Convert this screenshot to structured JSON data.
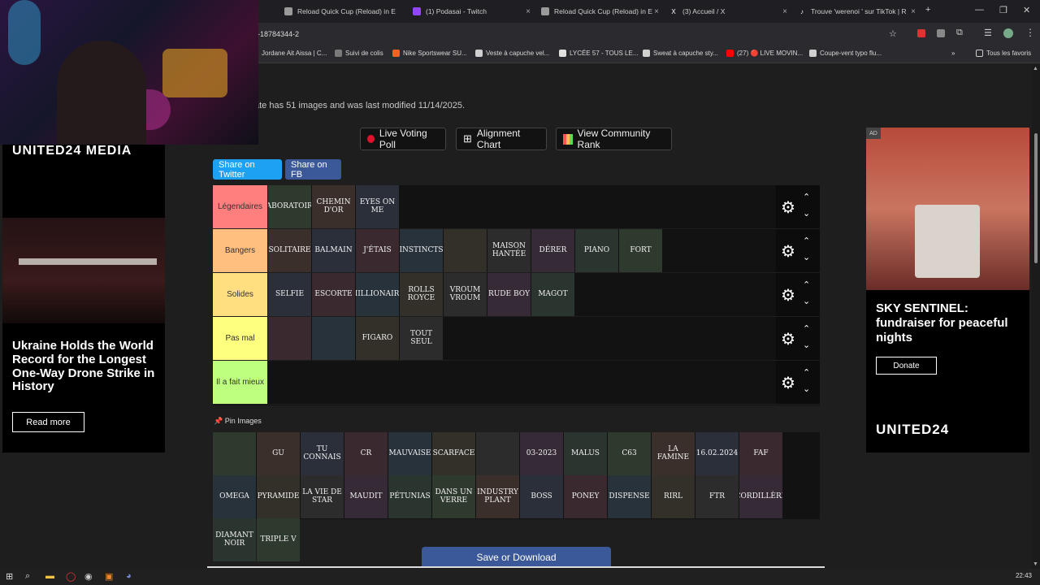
{
  "browser": {
    "tabs": [
      {
        "title": "Reload Quick Cup (Reload) in E",
        "icon_color": "#9a9a9a"
      },
      {
        "title": "(1) Podasai - Twitch",
        "icon_color": "#9146ff"
      },
      {
        "title": "Reload Quick Cup (Reload) in E",
        "icon_color": "#9a9a9a"
      },
      {
        "title": "(3) Accueil / X",
        "icon_color": "#ffffff"
      },
      {
        "title": "Trouve 'werenoi ' sur TikTok | R",
        "icon_color": "#ffffff"
      }
    ],
    "new_tab": "+",
    "url": "i-18784344-2",
    "bookmarks": [
      {
        "label": "Jordane Ait Aissa | C...",
        "color": "#7a7a7a"
      },
      {
        "label": "Suivi de colis",
        "color": "#7a7a7a"
      },
      {
        "label": "Nike Sportswear SU...",
        "color": "#f26322"
      },
      {
        "label": "Veste à capuche vel...",
        "color": "#d0d0d0"
      },
      {
        "label": "LYCÉE 57 - TOUS LE...",
        "color": "#e0e0e0"
      },
      {
        "label": "Sweat à capuche sty...",
        "color": "#d0d0d0"
      },
      {
        "label": "(27) 🔴 LIVE MOVIN...",
        "color": "#ff0000"
      },
      {
        "label": "Coupe-vent typo flu...",
        "color": "#d0d0d0"
      }
    ],
    "all_bookmarks": "Tous les favoris"
  },
  "page": {
    "subline": "ate has 51 images and was last modified 11/14/2025.",
    "buttons": {
      "live_poll": "Live Voting Poll",
      "alignment": "Alignment Chart",
      "community": "View Community Rank"
    },
    "share_twitter": "Share on Twitter",
    "share_fb": "Share on FB",
    "pin_images": "Pin Images",
    "save_download": "Save or Download"
  },
  "tiers": [
    {
      "label": "Légendaires",
      "color": "#ff7f7f",
      "items": [
        "LABORATOIRE",
        "CHEMIN D'OR",
        "EYES ON ME"
      ]
    },
    {
      "label": "Bangers",
      "color": "#ffbf7f",
      "items": [
        "SOLITAIRE",
        "BALMAIN",
        "J'ÉTAIS",
        "INSTINCTS",
        "",
        "MAISON HANTÉE",
        "DÉRER",
        "PIANO",
        "FORT"
      ]
    },
    {
      "label": "Solides",
      "color": "#ffdf7f",
      "items": [
        "SELFIE",
        "ESCORTE",
        "MILLIONAIRE",
        "ROLLS ROYCE",
        "VROUM VROUM",
        "RUDE BOY",
        "MAGOT"
      ]
    },
    {
      "label": "Pas mal",
      "color": "#ffff7f",
      "items": [
        "",
        "",
        "FIGARO",
        "TOUT SEUL"
      ]
    },
    {
      "label": "Il a fait mieux",
      "color": "#bfff7f",
      "items": []
    }
  ],
  "pool": [
    "",
    "GU",
    "TU CONNAIS",
    "CR",
    "MAUVAISE",
    "SCARFACE",
    "",
    "03-2023",
    "MALUS",
    "C63",
    "LA FAMINE",
    "16.02.2024",
    "FAF",
    "OMEGA",
    "PYRAMIDE",
    "LA VIE DE STAR",
    "MAUDIT",
    "PÉTUNIAS",
    "DANS UN VERRE",
    "INDUSTRY PLANT",
    "BOSS",
    "PONEY",
    "DISPENSE",
    "RIRL",
    "FTR",
    "CORDILLÈRE",
    "DIAMANT NOIR",
    "TRIPLE V"
  ],
  "ads": {
    "left": {
      "logo": "UNITED24 MEDIA",
      "headline": "Ukraine Holds the World Record for the Longest One-Way Drone Strike in History",
      "cta": "Read more"
    },
    "right": {
      "tag": "AD",
      "headline": "SKY SENTINEL: fundraiser for peaceful nights",
      "cta": "Donate",
      "logo": "UNITED24"
    }
  },
  "taskbar": {
    "time": "22:43"
  }
}
